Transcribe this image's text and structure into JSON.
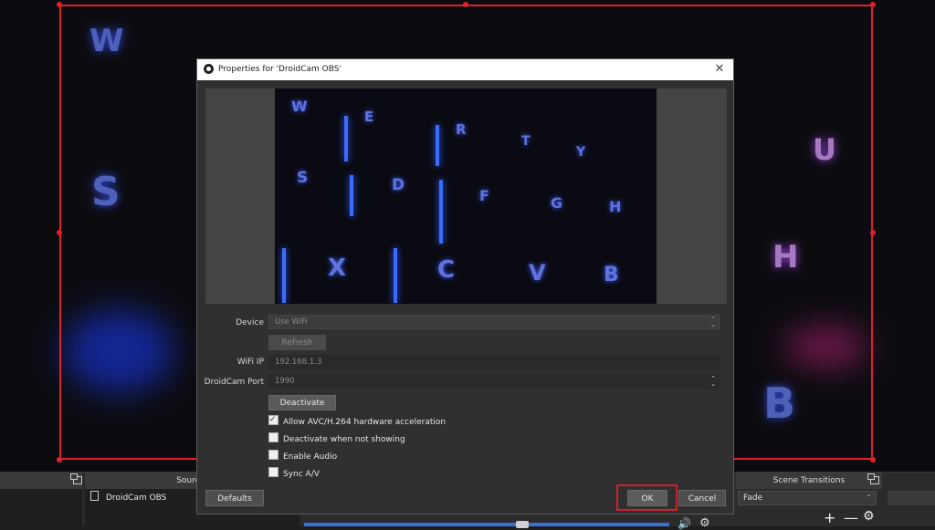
{
  "dialog": {
    "title": "Properties for 'DroidCam OBS'",
    "close_glyph": "✕",
    "device_label": "Device",
    "device_value": "Use WiFi",
    "refresh_label": "Refresh",
    "wifi_ip_label": "WiFi IP",
    "wifi_ip_value": "192.168.1.3",
    "port_label": "DroidCam Port",
    "port_value": "1990",
    "deactivate_label": "Deactivate",
    "checkboxes": [
      {
        "label": "Allow AVC/H.264 hardware acceleration",
        "checked": true
      },
      {
        "label": "Deactivate when not showing",
        "checked": false
      },
      {
        "label": "Enable Audio",
        "checked": false
      },
      {
        "label": "Sync A/V",
        "checked": false
      }
    ],
    "defaults_label": "Defaults",
    "ok_label": "OK",
    "cancel_label": "Cancel"
  },
  "preview_keys": [
    "W",
    "E",
    "R",
    "T",
    "Y",
    "S",
    "D",
    "F",
    "G",
    "H",
    "X",
    "C",
    "V",
    "B"
  ],
  "background_keys": [
    "W",
    "S",
    "U",
    "H",
    "B"
  ],
  "bottom": {
    "sources_title": "Sources",
    "source_item": "DroidCam OBS",
    "scene_transitions_title": "Scene Transitions",
    "transition_value": "Fade",
    "plus_glyph": "+",
    "minus_glyph": "—",
    "gear_glyph": "✿"
  },
  "colors": {
    "highlight": "#d0202a",
    "accent": "#3b6fd8"
  }
}
